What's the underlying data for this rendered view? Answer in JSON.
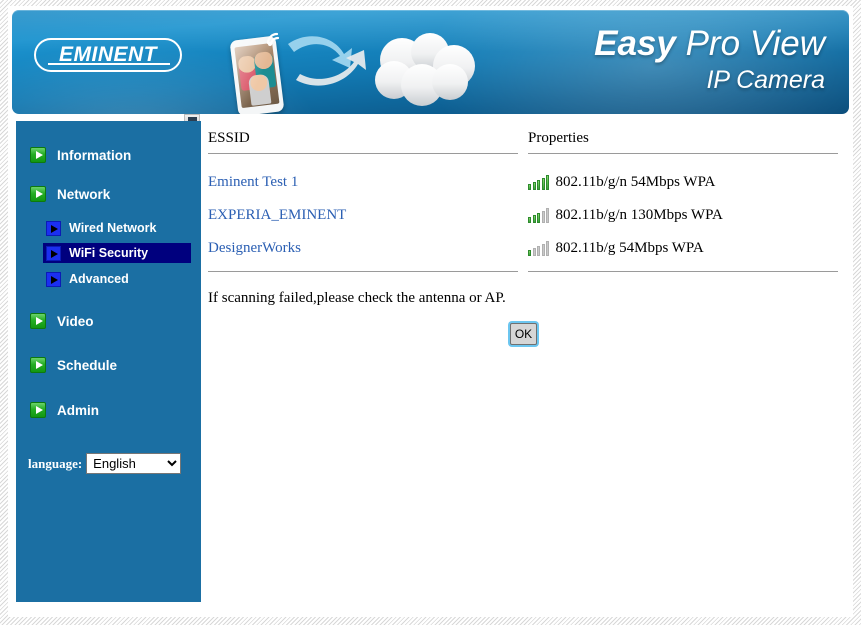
{
  "header": {
    "logo_text": "EMINENT",
    "title_primary": "Easy",
    "title_secondary": " Pro View",
    "title_sub": "IP Camera",
    "illustration_icons": [
      "smartphone-icon",
      "wifi-waves-icon",
      "sync-arrows-icon",
      "cloud-icon"
    ]
  },
  "sidebar": {
    "items": [
      {
        "label": "Information",
        "icon": "green-play-icon",
        "level": "top",
        "active": false
      },
      {
        "label": "Network",
        "icon": "green-play-icon",
        "level": "top",
        "active": false
      },
      {
        "label": "Wired Network",
        "icon": "blue-play-icon",
        "level": "sub",
        "active": false
      },
      {
        "label": "WiFi Security",
        "icon": "blue-play-icon",
        "level": "sub",
        "active": true
      },
      {
        "label": "Advanced",
        "icon": "blue-play-icon",
        "level": "sub",
        "active": false
      },
      {
        "label": "Video",
        "icon": "green-play-icon",
        "level": "top",
        "active": false
      },
      {
        "label": "Schedule",
        "icon": "green-play-icon",
        "level": "top",
        "active": false
      },
      {
        "label": "Admin",
        "icon": "green-play-icon",
        "level": "top",
        "active": false
      }
    ],
    "language": {
      "label": "language:",
      "selected": "English",
      "options": [
        "English"
      ]
    }
  },
  "main": {
    "columns": {
      "essid": "ESSID",
      "properties": "Properties"
    },
    "networks": [
      {
        "essid": "Eminent Test 1",
        "properties": "802.11b/g/n 54Mbps WPA",
        "signal_bars": 5,
        "signal_total": 5,
        "icon": "signal-strength-icon"
      },
      {
        "essid": "EXPERIA_EMINENT",
        "properties": "802.11b/g/n 130Mbps WPA",
        "signal_bars": 3,
        "signal_total": 5,
        "icon": "signal-strength-icon"
      },
      {
        "essid": "DesignerWorks",
        "properties": "802.11b/g 54Mbps WPA",
        "signal_bars": 1,
        "signal_total": 5,
        "icon": "signal-strength-icon"
      }
    ],
    "note": "If scanning failed,please check the antenna or AP.",
    "ok_label": "OK"
  },
  "colors": {
    "sidebar_bg": "#1b6fa3",
    "sidebar_active": "#00007e",
    "banner_blue": "#1279b2",
    "link_blue": "#2b5fb3",
    "signal_green": "#3ba23b",
    "signal_gray": "#c9c9c9",
    "focus_ring": "#6cc6f0"
  }
}
